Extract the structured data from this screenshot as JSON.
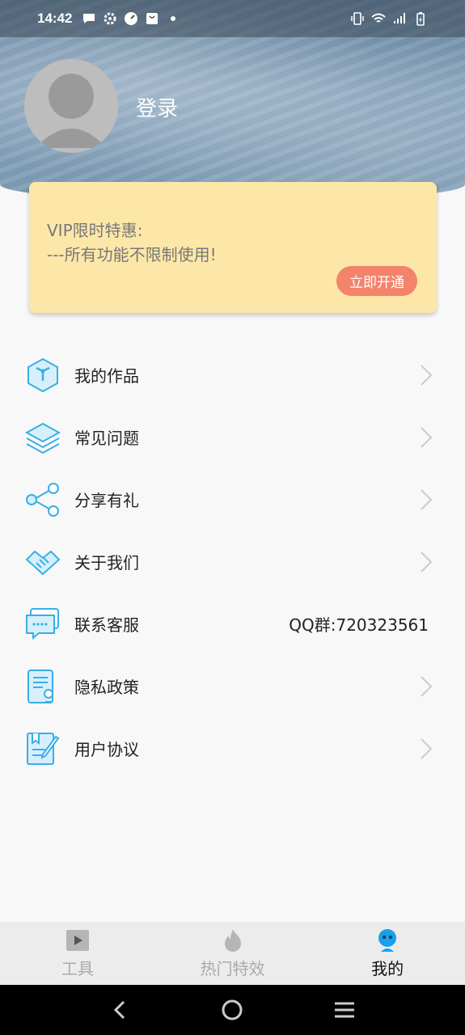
{
  "status_bar": {
    "time": "14:42",
    "left_icons": [
      "message-icon",
      "settings-icon",
      "speed-icon",
      "bag-icon",
      "dot-icon"
    ],
    "right_icons": [
      "vibrate-icon",
      "wifi-icon",
      "signal-icon",
      "battery-icon"
    ]
  },
  "profile": {
    "login_label": "登录"
  },
  "vip": {
    "line1": "VIP限时特惠:",
    "line2": "---所有功能不限制使用!",
    "button_label": "立即开通",
    "button_color": "#f4836b",
    "card_color": "#fde7a8"
  },
  "menu": {
    "items": [
      {
        "label": "我的作品",
        "icon": "cube-icon"
      },
      {
        "label": "常见问题",
        "icon": "layers-icon"
      },
      {
        "label": "分享有礼",
        "icon": "share-icon"
      },
      {
        "label": "关于我们",
        "icon": "handshake-icon"
      },
      {
        "label": "联系客服",
        "icon": "chat-icon",
        "value": "QQ群:720323561"
      },
      {
        "label": "隐私政策",
        "icon": "document-icon"
      },
      {
        "label": "用户协议",
        "icon": "agreement-icon"
      }
    ]
  },
  "tabbar": {
    "tabs": [
      {
        "label": "工具",
        "icon": "play-icon",
        "active": false
      },
      {
        "label": "热门特效",
        "icon": "flame-icon",
        "active": false
      },
      {
        "label": "我的",
        "icon": "user-icon",
        "active": true
      }
    ],
    "accent_color": "#1aa0e8"
  },
  "navbar": {
    "buttons": [
      "back-icon",
      "home-icon",
      "menu-icon"
    ]
  }
}
